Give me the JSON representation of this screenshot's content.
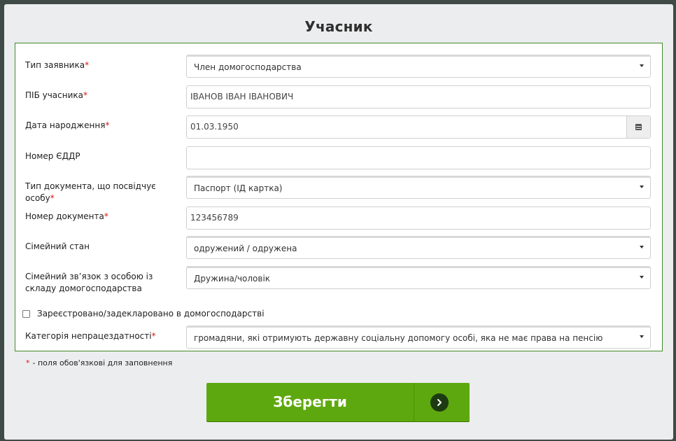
{
  "modal": {
    "title": "Учасник"
  },
  "form": {
    "applicant_type": {
      "label": "Тип заявника",
      "required": "*",
      "value": "Член домогосподарства"
    },
    "full_name": {
      "label": "ПІБ учасника",
      "required": "*",
      "value": "ІВАНОВ ІВАН ІВАНОВИЧ"
    },
    "birth_date": {
      "label": "Дата народження",
      "required": "*",
      "value": "01.03.1950",
      "icon": "calendar-icon"
    },
    "eddr_number": {
      "label": "Номер ЄДДР",
      "value": ""
    },
    "document_type": {
      "label": "Тип документа, що посвідчує особу",
      "required": "*",
      "value": "Паспорт (ІД картка)"
    },
    "document_number": {
      "label": "Номер документа",
      "required": "*",
      "value": "123456789"
    },
    "marital_status": {
      "label": "Сімейний стан",
      "value": "одружений / одружена"
    },
    "family_relation": {
      "label": "Сімейний зв’язок з особою із складу домогосподарства",
      "value": "Дружина/чоловік"
    },
    "registered_checkbox": {
      "label": "Зареєстровано/задекларовано в домогосподарстві",
      "checked": false
    },
    "disability_category": {
      "label": "Категорія непрацездатності",
      "required": "*",
      "value": "громадяни, які отримують державну соціальну допомогу особі, яка не має права на пенсію"
    }
  },
  "footnote": {
    "marker": "*",
    "text": "- поля обов'язкові для заповнення"
  },
  "actions": {
    "save_label": "Зберегти",
    "save_icon": "chevron-right-icon"
  },
  "colors": {
    "accent": "#5ea80f",
    "border": "#3f8a2a",
    "required": "#e01010"
  }
}
